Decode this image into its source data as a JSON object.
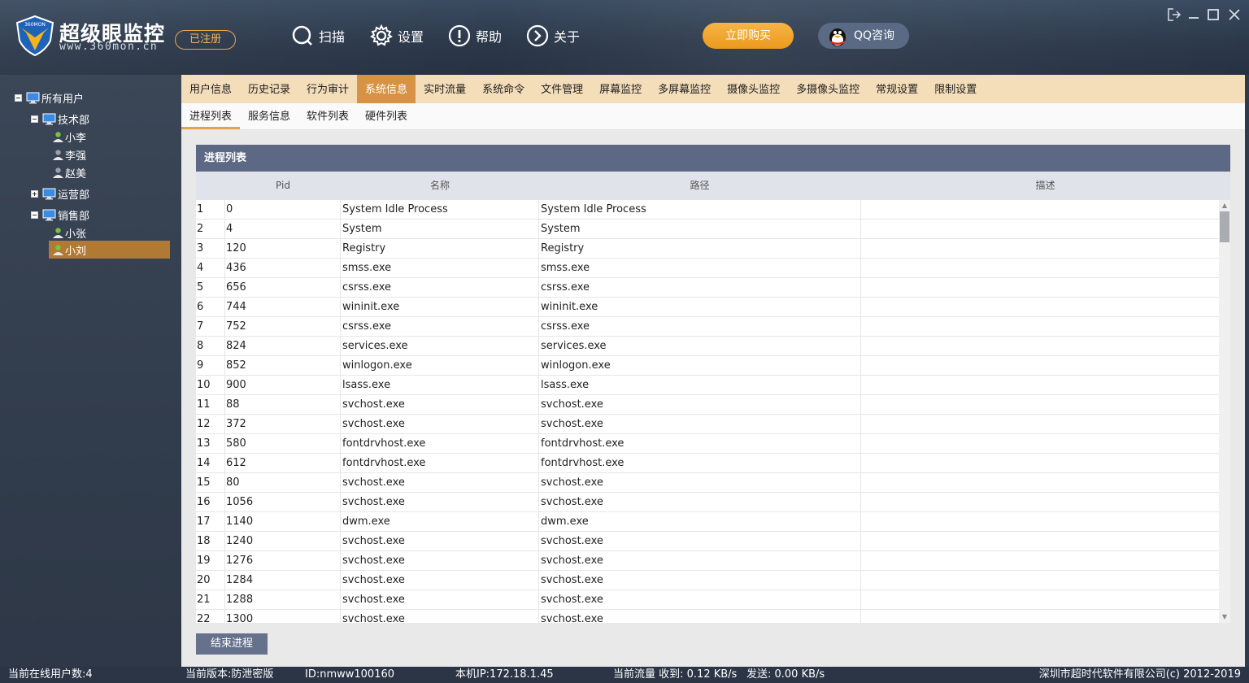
{
  "header": {
    "brand": "超级眼监控",
    "brand_url": "www.360mon.cn",
    "logo_text": "360MON",
    "registered": "已注册",
    "toolbar": [
      {
        "label": "扫描",
        "icon": "scan-icon"
      },
      {
        "label": "设置",
        "icon": "gear-icon"
      },
      {
        "label": "帮助",
        "icon": "help-icon"
      },
      {
        "label": "关于",
        "icon": "about-icon"
      }
    ],
    "buy_label": "立即购买",
    "qq_label": "QQ咨询",
    "accent_color": "#ec9a1e"
  },
  "sidebar": {
    "root": "所有用户",
    "groups": [
      {
        "label": "技术部",
        "expanded": true,
        "users": [
          "小李",
          "李强",
          "赵美"
        ]
      },
      {
        "label": "运营部",
        "expanded": false,
        "users": []
      },
      {
        "label": "销售部",
        "expanded": true,
        "users": [
          "小张",
          "小刘"
        ]
      }
    ],
    "selected_user": "小刘"
  },
  "main_tabs": [
    "用户信息",
    "历史记录",
    "行为审计",
    "系统信息",
    "实时流量",
    "系统命令",
    "文件管理",
    "屏幕监控",
    "多屏幕监控",
    "摄像头监控",
    "多摄像头监控",
    "常规设置",
    "限制设置"
  ],
  "main_tab_active": "系统信息",
  "sub_tabs": [
    "进程列表",
    "服务信息",
    "软件列表",
    "硬件列表"
  ],
  "sub_tab_active": "进程列表",
  "panel_title": "进程列表",
  "columns": [
    "",
    "Pid",
    "名称",
    "路径",
    "描述"
  ],
  "rows": [
    [
      "1",
      "0",
      "System Idle Process",
      "System Idle Process",
      ""
    ],
    [
      "2",
      "4",
      "System",
      "System",
      ""
    ],
    [
      "3",
      "120",
      "Registry",
      "Registry",
      ""
    ],
    [
      "4",
      "436",
      "smss.exe",
      "smss.exe",
      ""
    ],
    [
      "5",
      "656",
      "csrss.exe",
      "csrss.exe",
      ""
    ],
    [
      "6",
      "744",
      "wininit.exe",
      "wininit.exe",
      ""
    ],
    [
      "7",
      "752",
      "csrss.exe",
      "csrss.exe",
      ""
    ],
    [
      "8",
      "824",
      "services.exe",
      "services.exe",
      ""
    ],
    [
      "9",
      "852",
      "winlogon.exe",
      "winlogon.exe",
      ""
    ],
    [
      "10",
      "900",
      "lsass.exe",
      "lsass.exe",
      ""
    ],
    [
      "11",
      "88",
      "svchost.exe",
      "svchost.exe",
      ""
    ],
    [
      "12",
      "372",
      "svchost.exe",
      "svchost.exe",
      ""
    ],
    [
      "13",
      "580",
      "fontdrvhost.exe",
      "fontdrvhost.exe",
      ""
    ],
    [
      "14",
      "612",
      "fontdrvhost.exe",
      "fontdrvhost.exe",
      ""
    ],
    [
      "15",
      "80",
      "svchost.exe",
      "svchost.exe",
      ""
    ],
    [
      "16",
      "1056",
      "svchost.exe",
      "svchost.exe",
      ""
    ],
    [
      "17",
      "1140",
      "dwm.exe",
      "dwm.exe",
      ""
    ],
    [
      "18",
      "1240",
      "svchost.exe",
      "svchost.exe",
      ""
    ],
    [
      "19",
      "1276",
      "svchost.exe",
      "svchost.exe",
      ""
    ],
    [
      "20",
      "1284",
      "svchost.exe",
      "svchost.exe",
      ""
    ],
    [
      "21",
      "1288",
      "svchost.exe",
      "svchost.exe",
      ""
    ],
    [
      "22",
      "1300",
      "svchost.exe",
      "svchost.exe",
      ""
    ]
  ],
  "kill_button": "结束进程",
  "status": {
    "online_users": "当前在线用户数:4",
    "version": "当前版本:防泄密版",
    "id": "ID:nmww100160",
    "ip": "本机IP:172.18.1.45",
    "traffic_recv": "当前流量 收到: 0.12 KB/s",
    "traffic_send": "发送: 0.00 KB/s",
    "copyright": "深圳市超时代软件有限公司(c) 2012-2019"
  }
}
